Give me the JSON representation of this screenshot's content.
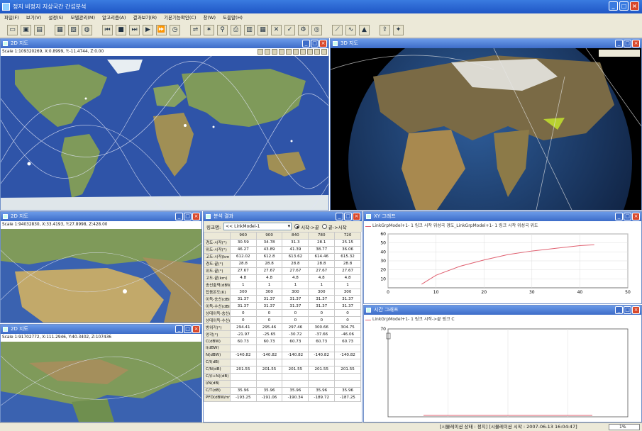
{
  "app": {
    "title": "정지 비정지 지상국간 간섭분석"
  },
  "menu": [
    "파일(F)",
    "보기(V)",
    "설정(S)",
    "모델관리(M)",
    "알고리즘(A)",
    "결과보기(R)",
    "기본기능확인(C)",
    "창(W)",
    "도움말(H)"
  ],
  "toolbar_icons": [
    "open-icon",
    "save-icon",
    "saveas-icon",
    "grid-icon",
    "map-icon",
    "globe-icon",
    "skip-back-icon",
    "stop-icon",
    "step-icon",
    "play-icon",
    "fast-forward-icon",
    "clock-icon",
    "link-icon",
    "satellite-icon",
    "antenna-icon",
    "printer-icon",
    "chart-icon",
    "table-icon",
    "tools-icon",
    "check-icon",
    "gear-icon",
    "target-icon",
    "xy-graph-icon",
    "line-graph-icon",
    "area-graph-icon",
    "export-icon",
    "lamp-icon"
  ],
  "map_main": {
    "title": "2D 지도",
    "scale": "Scale 1:109320269, X:0.8999, Y:-11.4744, Z:0.00"
  },
  "map_3d": {
    "title": "3D 지도"
  },
  "map_mid": {
    "title": "2D 지도",
    "scale": "Scale 1:94032830, X:33.4193, Y:27.8998, Z:428.00"
  },
  "map_low": {
    "title": "2D 지도",
    "scale": "Scale 1:91702772, X:111.2946, Y:40.3402, Z:107436"
  },
  "analysis": {
    "title": "분석 결과",
    "link_label": "링크명:",
    "link_value": "<< LinkModel-1",
    "radio1": "시작->끝",
    "radio2": "끝->시작",
    "columns": [
      "960",
      "900",
      "840",
      "780",
      "720"
    ],
    "rows": [
      {
        "label": "경도-시작(°)",
        "values": [
          "30.59",
          "34.78",
          "31.3",
          "28.1",
          "25.15"
        ]
      },
      {
        "label": "위도-시작(°)",
        "values": [
          "46.27",
          "43.89",
          "41.39",
          "38.77",
          "36.06"
        ]
      },
      {
        "label": "고도-시작(km)",
        "values": [
          "612.02",
          "612.8",
          "613.62",
          "614.46",
          "615.32"
        ]
      },
      {
        "label": "경도-끝(°)",
        "values": [
          "28.8",
          "28.8",
          "28.8",
          "28.8",
          "28.8"
        ]
      },
      {
        "label": "위도-끝(°)",
        "values": [
          "27.67",
          "27.67",
          "27.67",
          "27.67",
          "27.67"
        ]
      },
      {
        "label": "고도-끝(km)",
        "values": [
          "4.8",
          "4.8",
          "4.8",
          "4.8",
          "4.8"
        ]
      },
      {
        "label": "송신출력(dBW)",
        "values": [
          "1",
          "1",
          "1",
          "1",
          "1"
        ]
      },
      {
        "label": "잡음온도(K)",
        "values": [
          "300",
          "300",
          "300",
          "300",
          "300"
        ]
      },
      {
        "label": "이득-송신(dBi)",
        "values": [
          "31.37",
          "31.37",
          "31.37",
          "31.37",
          "31.37"
        ]
      },
      {
        "label": "이득-수신(dBi)",
        "values": [
          "31.37",
          "31.37",
          "31.37",
          "31.37",
          "31.37"
        ]
      },
      {
        "label": "상대이득-송신(dBi)",
        "values": [
          "0",
          "0",
          "0",
          "0",
          "0"
        ]
      },
      {
        "label": "상대이득-수신(dBi)",
        "values": [
          "0",
          "0",
          "0",
          "0",
          "0"
        ]
      },
      {
        "label": "방위각(°)",
        "values": [
          "294.41",
          "295.46",
          "297.46",
          "300.66",
          "304.75"
        ]
      },
      {
        "label": "앙각(°)",
        "values": [
          "-21.97",
          "-25.65",
          "-30.72",
          "-37.66",
          "-46.06"
        ]
      },
      {
        "label": "C(dBW)",
        "values": [
          "60.73",
          "60.73",
          "60.73",
          "60.73",
          "60.73"
        ]
      },
      {
        "label": "I(dBW)",
        "values": [
          "",
          "",
          "",
          "",
          ""
        ]
      },
      {
        "label": "N(dBW)",
        "values": [
          "-140.82",
          "-140.82",
          "-140.82",
          "-140.82",
          "-140.82"
        ]
      },
      {
        "label": "C/I(dB)",
        "values": [
          "",
          "",
          "",
          "",
          ""
        ]
      },
      {
        "label": "C/N(dB)",
        "values": [
          "201.55",
          "201.55",
          "201.55",
          "201.55",
          "201.55"
        ]
      },
      {
        "label": "C/(I+N)(dB)",
        "values": [
          "",
          "",
          "",
          "",
          ""
        ]
      },
      {
        "label": "I/N(dB)",
        "values": [
          "",
          "",
          "",
          "",
          ""
        ]
      },
      {
        "label": "C/T(dB)",
        "values": [
          "35.96",
          "35.96",
          "35.96",
          "35.96",
          "35.96"
        ]
      },
      {
        "label": "PFD(dBW/m²)",
        "values": [
          "-193.25",
          "-191.06",
          "-190.34",
          "-189.72",
          "-187.25"
        ]
      }
    ]
  },
  "xy_graph": {
    "title": "XY 그래프",
    "legend": "LinkGrpModel+1- 1 링크 시작 위성국 경도_LinkGrpModel+1- 1 링크 시작 위성국 위도"
  },
  "time_graph": {
    "title": "시간 그래프",
    "legend": "LinkGrpModel+1- 1 링크 시작->끝 링크 C"
  },
  "chart_data": [
    {
      "type": "line",
      "title": "",
      "xlabel": "",
      "ylabel": "",
      "xlim": [
        0,
        50
      ],
      "ylim": [
        0,
        60
      ],
      "xticks": [
        0,
        10,
        20,
        30,
        40,
        50
      ],
      "yticks": [
        10,
        20,
        30,
        40,
        50,
        60
      ],
      "grid": true,
      "legend_position": "top",
      "series": [
        {
          "name": "LinkGrpModel+1- 1 링크 시작 위성국 경도_LinkGrpModel+1- 1 링크 시작 위성국 위도",
          "color": "#e06070",
          "x": [
            7,
            10,
            15,
            20,
            25,
            30,
            35,
            40,
            43
          ],
          "y": [
            4,
            14,
            24,
            31,
            37,
            41,
            44,
            47,
            48
          ]
        }
      ]
    },
    {
      "type": "line",
      "title": "",
      "xlabel": "",
      "ylabel": "",
      "ylim": [
        0,
        70
      ],
      "yticks": [
        70
      ],
      "grid": true,
      "legend_position": "top",
      "series": [
        {
          "name": "LinkGrpModel+1- 1 링크 시작->끝 링크 C",
          "color": "#e06070",
          "x": [],
          "y": []
        }
      ]
    }
  ],
  "status": {
    "text": "[시뮬레이션 상태 : 정지] [시뮬레이션 시작 : 2007-06-13 16:04:47]",
    "progress": "1%"
  },
  "colors": {
    "title_blue": "#1f56c5",
    "pane_blue": "#3d6cc8",
    "ocean": "#2f54a8",
    "land": "#7f9a5a",
    "series": "#e06070"
  }
}
